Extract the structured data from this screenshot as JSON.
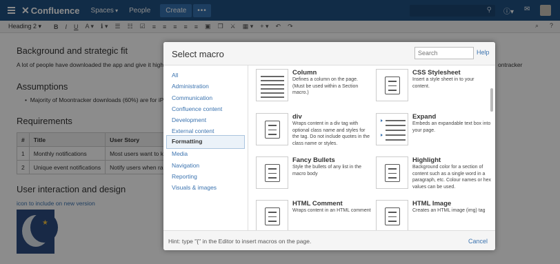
{
  "app": {
    "name": "Confluence",
    "nav": [
      "Spaces",
      "People"
    ],
    "create_label": "Create",
    "more_label": "•••"
  },
  "toolbar": {
    "style": "Heading 2",
    "tools": [
      "B",
      "I",
      "U",
      "A ▾",
      "ℹ ▾",
      "☰",
      "☷",
      "☑",
      "≡",
      "≡",
      "≡",
      "≡",
      "≡",
      "▣",
      "❒",
      "⚔",
      "▦ ▾",
      "+ ▾",
      "↶",
      "↷"
    ],
    "right": [
      "⌕",
      "?"
    ]
  },
  "page": {
    "h_background": "Background and strategic fit",
    "background_text": "A lot of people have downloaded the app and give it high ratings",
    "background_tail": "ontracker",
    "h_assumptions": "Assumptions",
    "assumption_1": "Majority of Moontracker downloads (60%) are for iPho",
    "h_requirements": "Requirements",
    "table": {
      "headers": [
        "#",
        "Title",
        "User Story"
      ],
      "rows": [
        [
          "1",
          "Monthly notifications",
          "Most users want to know"
        ],
        [
          "2",
          "Unique event notifications",
          "Notify users when rare e"
        ]
      ]
    },
    "h_design": "User interaction and design",
    "design_link": "icon to include on new version"
  },
  "dialog": {
    "title": "Select macro",
    "search_placeholder": "Search",
    "help_label": "Help",
    "categories": [
      "All",
      "Administration",
      "Communication",
      "Confluence content",
      "Development",
      "External content",
      "Formatting",
      "Media",
      "Navigation",
      "Reporting",
      "Visuals & images"
    ],
    "selected_category": "Formatting",
    "macros": [
      {
        "name": "Column",
        "desc": "Defines a column on the page. (Must be used within a Section macro.)",
        "icon": "column-layout-icon"
      },
      {
        "name": "CSS Stylesheet",
        "desc": "Insert a style sheet in to your content.",
        "icon": "scroll-icon"
      },
      {
        "name": "div",
        "desc": "Wraps content in a div tag with optional class name and styles for the tag. Do not include quotes in the class name or styles.",
        "icon": "scroll-icon"
      },
      {
        "name": "Expand",
        "desc": "Embeds an expandable text box into your page.",
        "icon": "expand-icon"
      },
      {
        "name": "Fancy Bullets",
        "desc": "Style the bullets of any list in the macro body",
        "icon": "scroll-icon"
      },
      {
        "name": "Highlight",
        "desc": "Background color for a section of content such as a single word in a paragraph, etc. Colour names or hex values can be used.",
        "icon": "scroll-icon"
      },
      {
        "name": "HTML Comment",
        "desc": "Wraps content in an HTML comment",
        "icon": "scroll-icon"
      },
      {
        "name": "HTML Image",
        "desc": "Creates an HTML image (img) tag",
        "icon": "scroll-icon"
      }
    ],
    "hint": "Hint: type \"{\" in the Editor to insert macros on the page.",
    "cancel_label": "Cancel"
  },
  "colors": {
    "nav_bg": "#205081",
    "link": "#3b73af",
    "selected_bg": "#ebf2f9"
  }
}
